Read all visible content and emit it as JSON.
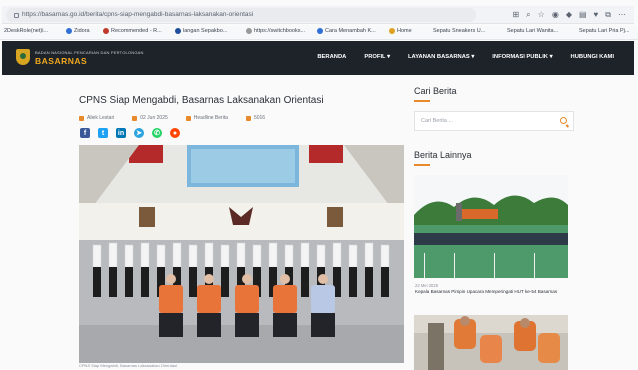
{
  "browser": {
    "url": "https://basarnas.go.id/berita/cpns-siap-mengabdi-basarnas-laksanakan-orientasi",
    "bookmarks": [
      {
        "label": "2DeskRole(net)i..."
      },
      {
        "label": "Zidora"
      },
      {
        "label": "Recommended - R..."
      },
      {
        "label": "langan Sepakbo..."
      },
      {
        "label": "https://switchbooks..."
      },
      {
        "label": "Cara Menambah K..."
      },
      {
        "label": "Home"
      },
      {
        "label": "Sepatu Sneakers U..."
      },
      {
        "label": "Sepatu Lari Wanita..."
      },
      {
        "label": "Sepatu Lari Pria Pj..."
      }
    ]
  },
  "header": {
    "agency_small": "BADAN NASIONAL PENCARIAN DAN PERTOLONGAN",
    "agency_name": "BASARNAS",
    "nav": [
      "BERANDA",
      "PROFIL ▾",
      "LAYANAN BASARNAS ▾",
      "INFORMASI PUBLIK ▾",
      "HUBUNGI KAMI"
    ]
  },
  "article": {
    "title": "CPNS Siap Mengabdi, Basarnas Laksanakan Orientasi",
    "author": "Aliek Lestari",
    "date": "02 Jun 2025",
    "category": "Headline Berita",
    "views": "5016",
    "caption": "CPNS Siap Mengabdi, Basarnas Laksanakan Orientasi"
  },
  "sidebar": {
    "search_heading": "Cari Berita",
    "search_placeholder": "Cari Berita ...",
    "other_heading": "Berita Lainnya",
    "news": [
      {
        "date": "22 Mei 2025",
        "title": "Kepala Basarnas Pimpin Upacara Memperingati HUT ke-54 Basarnas"
      }
    ]
  },
  "colors": {
    "header_bg": "#1d2329",
    "brand_orange": "#f0a81e",
    "accent": "#e88a2b"
  }
}
